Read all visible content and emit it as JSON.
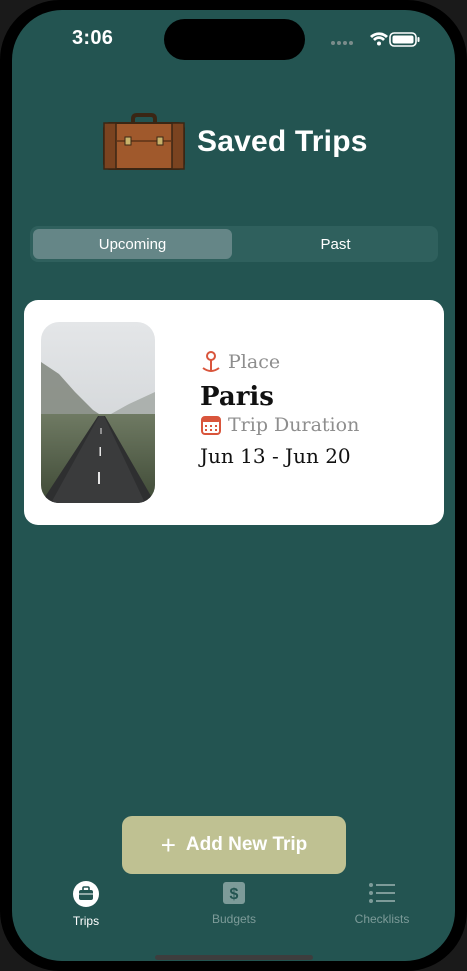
{
  "status_bar": {
    "time": "3:06"
  },
  "header": {
    "title": "Saved Trips",
    "icon": "suitcase-icon"
  },
  "segmented": {
    "tabs": [
      {
        "label": "Upcoming",
        "selected": true
      },
      {
        "label": "Past",
        "selected": false
      }
    ]
  },
  "trip_card": {
    "place_label": "Place",
    "place_value": "Paris",
    "duration_label": "Trip Duration",
    "duration_value": "Jun 13 - Jun 20"
  },
  "add_button": {
    "label": "Add New Trip"
  },
  "tab_bar": {
    "items": [
      {
        "label": "Trips",
        "icon": "briefcase-icon",
        "active": true
      },
      {
        "label": "Budgets",
        "icon": "dollar-icon",
        "active": false
      },
      {
        "label": "Checklists",
        "icon": "list-icon",
        "active": false
      }
    ]
  },
  "colors": {
    "background": "#235451",
    "card": "#ffffff",
    "button": "#bfc192",
    "accent_red": "#d9553c"
  }
}
